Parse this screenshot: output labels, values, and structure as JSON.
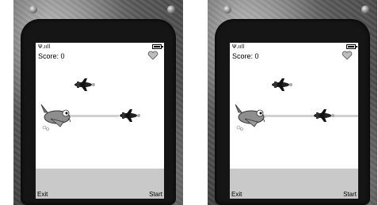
{
  "screens": [
    {
      "status": {
        "signal": "Ψ.ııll",
        "battery_level": 1.0
      },
      "score_label": "Score: 0",
      "softkeys": {
        "left": "Exit",
        "right": "Start"
      },
      "sprites": [
        "heart-icon",
        "enemy-plane-icon",
        "enemy-plane-icon",
        "player-plane-icon"
      ]
    },
    {
      "status": {
        "signal": "Ψ.ııll",
        "battery_level": 1.0
      },
      "score_label": "Score: 0",
      "softkeys": {
        "left": "Exit",
        "right": "Start"
      },
      "sprites": [
        "heart-icon",
        "enemy-plane-icon",
        "enemy-plane-icon",
        "player-plane-icon"
      ]
    }
  ],
  "colors": {
    "screen_bg": "#ffffff",
    "ground": "#c9c9c9",
    "phone_body": "#5a5a5a"
  }
}
